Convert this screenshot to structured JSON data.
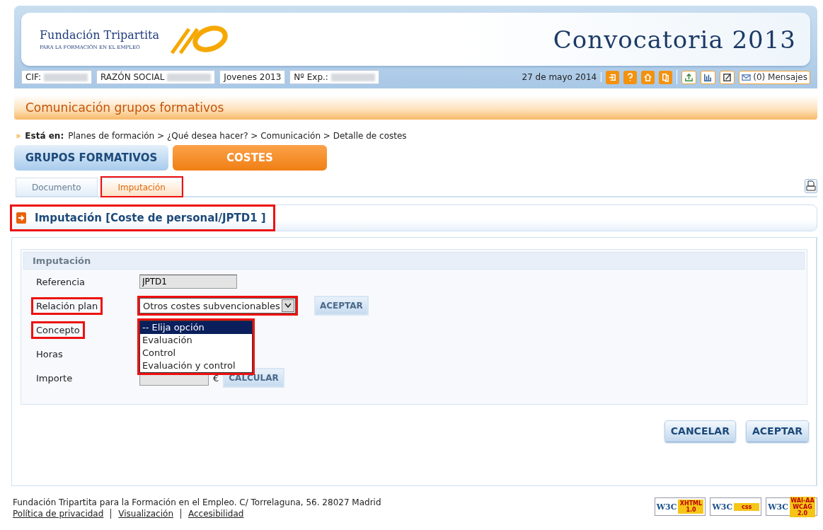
{
  "header": {
    "logo_title": "Fundación Tripartita",
    "logo_subtitle": "PARA LA FORMACIÓN EN EL EMPLEO",
    "banner_title": "Convocatoria 2013"
  },
  "info_bar": {
    "fields": [
      {
        "label": "CIF:",
        "blurred": true
      },
      {
        "label": "RAZÓN SOCIAL",
        "blurred": true
      },
      {
        "label": "Jovenes 2013",
        "blurred": false
      },
      {
        "label": "Nº Exp.:",
        "blurred": true
      }
    ],
    "date": "27 de mayo 2014",
    "messages": "(0) Mensajes"
  },
  "page_title": "Comunicación grupos formativos",
  "breadcrumb": {
    "marker": "»",
    "prefix": "Está en:",
    "path": "Planes de formación > ¿Qué desea hacer? > Comunicación > Detalle de costes"
  },
  "main_tabs": [
    {
      "label": "GRUPOS FORMATIVOS",
      "selected": false
    },
    {
      "label": "COSTES",
      "selected": true
    }
  ],
  "sub_tabs": [
    {
      "label": "Documento",
      "selected": false,
      "highlighted": false
    },
    {
      "label": "Imputación",
      "selected": true,
      "highlighted": true
    }
  ],
  "section": {
    "title": "Imputación [Coste de personal/JPTD1 ]",
    "highlighted": true
  },
  "form": {
    "legend": "Imputación",
    "rows": [
      {
        "kind": "readonly",
        "label": "Referencia",
        "value": "JPTD1",
        "highlighted": false
      },
      {
        "kind": "select",
        "label": "Relación plan",
        "value": "Otros costes subvencionables",
        "button": "ACEPTAR",
        "highlighted": true
      },
      {
        "kind": "listbox",
        "label": "Concepto",
        "highlighted": true,
        "options": [
          {
            "label": "-- Elija opción",
            "selected": true
          },
          {
            "label": "Evaluación",
            "selected": false
          },
          {
            "label": "Control",
            "selected": false
          },
          {
            "label": "Evaluación y control",
            "selected": false
          }
        ]
      },
      {
        "kind": "hidden",
        "label": "Horas",
        "highlighted": false
      },
      {
        "kind": "amount",
        "label": "Importe",
        "unit": "€",
        "button": "CALCULAR",
        "highlighted": false
      }
    ]
  },
  "actions": [
    "CANCELAR",
    "ACEPTAR"
  ],
  "footer": {
    "address": "Fundación Tripartita para la Formación en el Empleo. C/ Torrelaguna, 56. 28027 Madrid",
    "links": [
      "Política de privacidad",
      "Visualización",
      "Accesibilidad"
    ],
    "badges": [
      {
        "logo": "W3C",
        "label": "XHTML 1.0"
      },
      {
        "logo": "W3C",
        "label": "css"
      },
      {
        "logo": "W3C",
        "label": "WAI-AA WCAG 2.0"
      }
    ]
  }
}
